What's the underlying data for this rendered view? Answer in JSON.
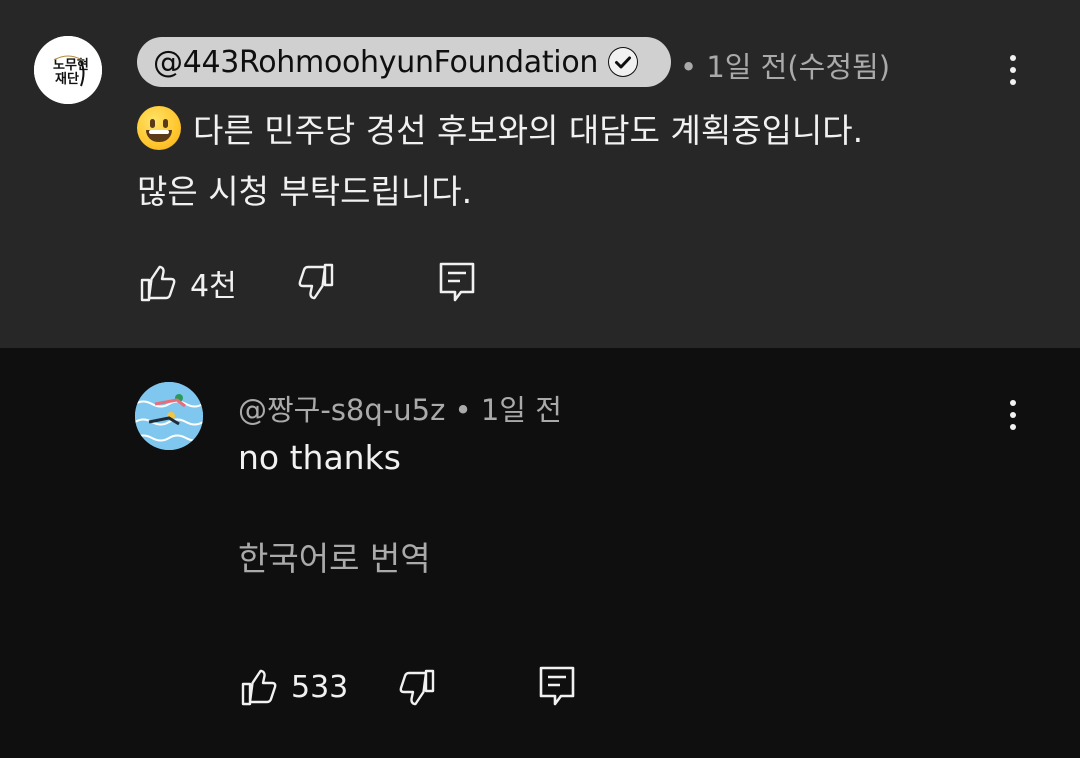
{
  "top_comment": {
    "author": "@443RohmoohyunFoundation",
    "verified": true,
    "meta": "• 1일 전(수정됨)",
    "emoji": "😀",
    "line1": "다른 민주당 경선 후보와의 대담도 계획중입니다.",
    "line2": "많은 시청 부탁드립니다.",
    "likes": "4천",
    "avatar_icon": "foundation-logo-icon"
  },
  "reply_comment": {
    "author": "@짱구-s8q-u5z",
    "meta": " • 1일 전",
    "body": "no thanks",
    "translate_label": "한국어로 번역",
    "likes": "533",
    "avatar_icon": "swimmers-avatar-icon"
  },
  "colors": {
    "top_background": "#272727",
    "page_background": "#0f0f0f",
    "secondary_text": "#aaaaaa",
    "author_chip": "#d0d0d0"
  }
}
